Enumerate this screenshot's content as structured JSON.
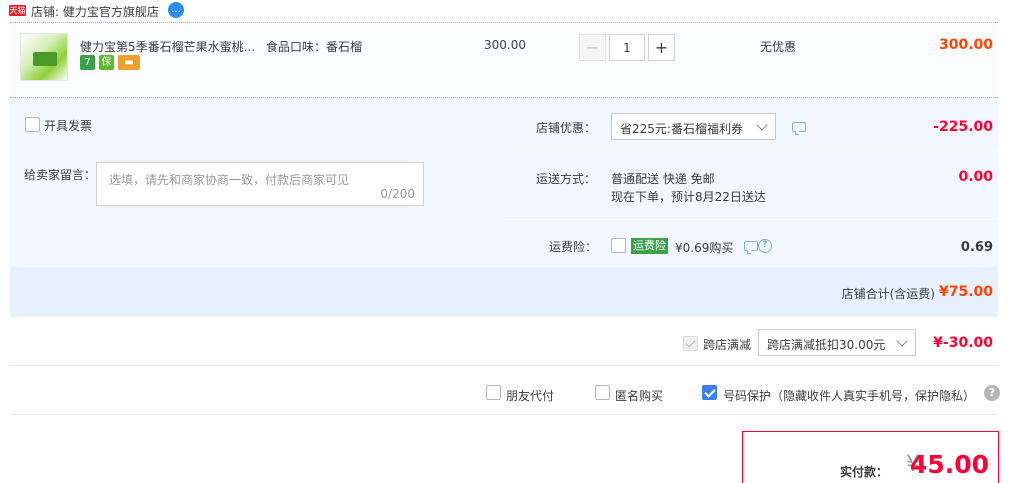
{
  "shop": {
    "badge": "天猫",
    "label": "店铺: 健力宝官方旗舰店",
    "chat_icon": "chat-bubble-icon"
  },
  "item": {
    "title": "健力宝第5季番石榴芒果水蜜桃...",
    "attribute": "食品口味：番石榴",
    "price": "300.00",
    "quantity": "1",
    "minus": "−",
    "plus": "+",
    "promotion": "无优惠",
    "subtotal": "300.00",
    "service_icons": [
      "seven-day-return-icon",
      "guarantee-icon",
      "card-icon"
    ],
    "service_glyphs": [
      "7",
      "保",
      "▬"
    ]
  },
  "invoice": {
    "label": "开具发票"
  },
  "message": {
    "label": "给卖家留言：",
    "placeholder": "选填，请先和商家协商一致，付款后商家可见",
    "counter": "0/200"
  },
  "store_discount": {
    "label": "店铺优惠：",
    "selected": "省225元:番石榴福利券",
    "amount": "-225.00"
  },
  "shipping": {
    "label": "运送方式：",
    "method": "普通配送 快递 免邮",
    "eta": "现在下单，预计8月22日送达",
    "amount": "0.00"
  },
  "insurance": {
    "label": "运费险：",
    "badge": "运费险",
    "price_text": "¥0.69购买",
    "amount": "0.69"
  },
  "store_total": {
    "label": "店铺合计(含运费)",
    "amount": "¥75.00"
  },
  "cross_store": {
    "label": "跨店满减",
    "selected": "跨店满减抵扣30.00元",
    "amount": "¥-30.00"
  },
  "extras": {
    "friend_pay": "朋友代付",
    "anonymous": "匿名购买",
    "privacy": "号码保护（隐藏收件人真实手机号，保护隐私）"
  },
  "payment": {
    "label": "实付款：",
    "currency": "¥",
    "amount": "45.00"
  },
  "colors": {
    "accent_red": "#ff0036",
    "orange": "#ff4400",
    "panel_blue": "#f2f7ff",
    "check_blue": "#3d7ff0",
    "insurance_green": "#3aa148"
  }
}
